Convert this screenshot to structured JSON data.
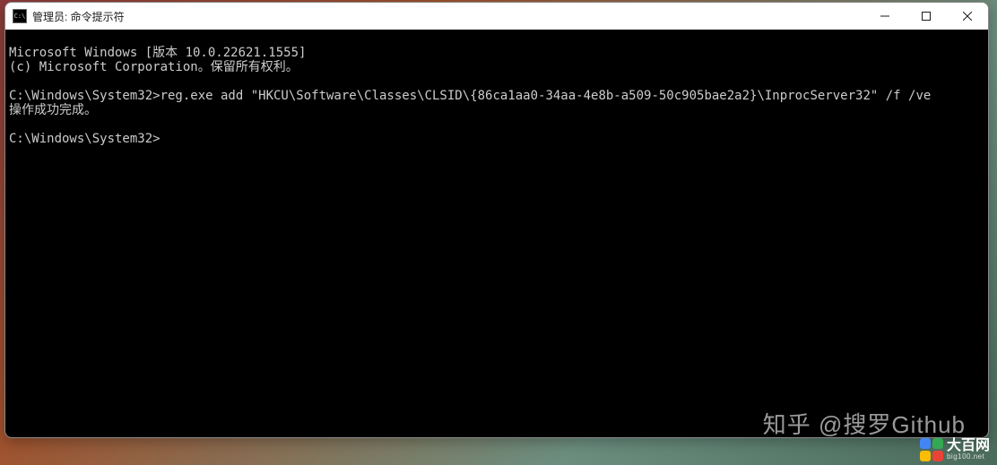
{
  "window": {
    "title": "管理员: 命令提示符",
    "icon_label": "C:\\"
  },
  "terminal": {
    "line1": "Microsoft Windows [版本 10.0.22621.1555]",
    "line2": "(c) Microsoft Corporation。保留所有权利。",
    "blank1": "",
    "line3": "C:\\Windows\\System32>reg.exe add \"HKCU\\Software\\Classes\\CLSID\\{86ca1aa0-34aa-4e8b-a509-50c905bae2a2}\\InprocServer32\" /f /ve",
    "line4": "操作成功完成。",
    "blank2": "",
    "prompt": "C:\\Windows\\System32>"
  },
  "watermarks": {
    "zhihu": "知乎 @搜罗Github",
    "logo_title": "大百网",
    "logo_sub": "big100.net"
  }
}
